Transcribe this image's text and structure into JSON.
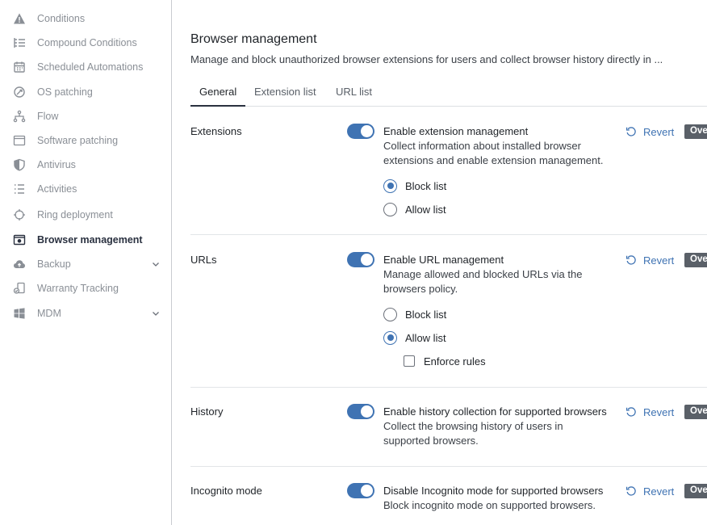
{
  "sidebar": {
    "items": [
      {
        "label": "Conditions",
        "icon": "warning-icon"
      },
      {
        "label": "Compound Conditions",
        "icon": "list-tree-icon"
      },
      {
        "label": "Scheduled Automations",
        "icon": "calendar-icon"
      },
      {
        "label": "OS patching",
        "icon": "patch-icon"
      },
      {
        "label": "Flow",
        "icon": "flow-icon"
      },
      {
        "label": "Software patching",
        "icon": "window-icon"
      },
      {
        "label": "Antivirus",
        "icon": "shield-icon"
      },
      {
        "label": "Activities",
        "icon": "list-icon"
      },
      {
        "label": "Ring deployment",
        "icon": "target-icon"
      },
      {
        "label": "Browser management",
        "icon": "browser-gear-icon",
        "active": true
      },
      {
        "label": "Backup",
        "icon": "cloud-upload-icon",
        "expandable": true
      },
      {
        "label": "Warranty Tracking",
        "icon": "device-check-icon"
      },
      {
        "label": "MDM",
        "icon": "windows-icon",
        "expandable": true
      }
    ]
  },
  "header": {
    "title": "Browser management",
    "subtitle": "Manage and block unauthorized browser extensions for users and collect browser history directly in ..."
  },
  "tabs": [
    {
      "label": "General",
      "active": true
    },
    {
      "label": "Extension list"
    },
    {
      "label": "URL list"
    }
  ],
  "sections": {
    "extensions": {
      "label": "Extensions",
      "toggle_on": true,
      "title": "Enable extension management",
      "desc_line1": "Collect information about installed browser",
      "desc_line2": "extensions and enable extension management.",
      "radio_block": "Block list",
      "radio_allow": "Allow list",
      "selected": "Block list",
      "revert": "Revert",
      "override": "Ove"
    },
    "urls": {
      "label": "URLs",
      "toggle_on": true,
      "title": "Enable URL management",
      "desc_line1": "Manage allowed and blocked URLs via the",
      "desc_line2": "browsers policy.",
      "radio_block": "Block list",
      "radio_allow": "Allow list",
      "selected": "Allow list",
      "enforce": "Enforce rules",
      "enforce_checked": false,
      "revert": "Revert",
      "override": "Ove"
    },
    "history": {
      "label": "History",
      "toggle_on": true,
      "title": "Enable history collection for supported browsers",
      "desc_line1": "Collect the browsing history of users in",
      "desc_line2": "supported browsers.",
      "revert": "Revert",
      "override": "Ove"
    },
    "incognito": {
      "label": "Incognito mode",
      "toggle_on": true,
      "title": "Disable Incognito mode for supported browsers",
      "desc_line1": "Block incognito mode on supported browsers.",
      "revert": "Revert",
      "override": "Ove"
    }
  },
  "colors": {
    "accent": "#3f73b3",
    "muted_text": "#8a8f96",
    "badge": "#5a6068"
  }
}
